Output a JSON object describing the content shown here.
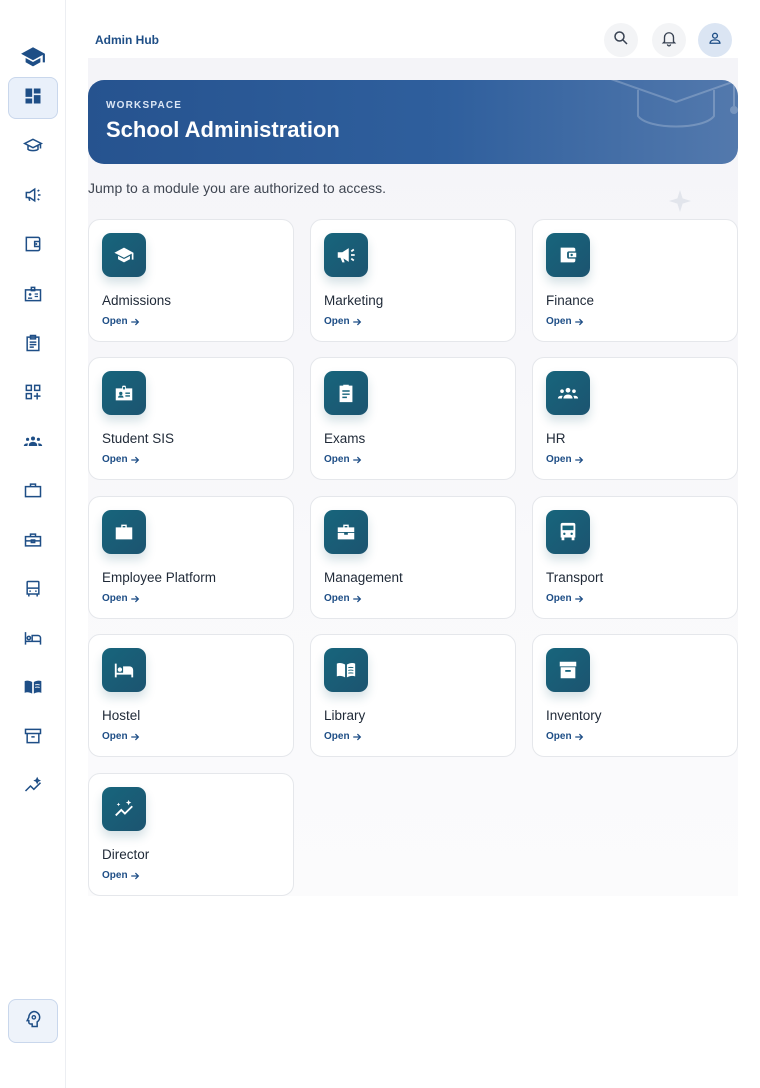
{
  "app": {
    "title": "Admin Hub"
  },
  "hero": {
    "eyebrow": "WORKSPACE",
    "title": "School Administration"
  },
  "subtitle": "Jump to a module you are authorized to access.",
  "colors": {
    "brand": "#1e4e86",
    "hero_start": "#26538f",
    "icon_tile": "#17657c"
  },
  "sidebar": {
    "items": [
      {
        "icon": "dashboard-icon",
        "active": true
      },
      {
        "icon": "graduation-cap-icon"
      },
      {
        "icon": "megaphone-icon"
      },
      {
        "icon": "wallet-icon"
      },
      {
        "icon": "id-badge-icon"
      },
      {
        "icon": "clipboard-icon"
      },
      {
        "icon": "add-widget-icon"
      },
      {
        "icon": "group-icon"
      },
      {
        "icon": "briefcase-icon"
      },
      {
        "icon": "toolbox-icon"
      },
      {
        "icon": "bus-icon"
      },
      {
        "icon": "bed-icon"
      },
      {
        "icon": "book-icon"
      },
      {
        "icon": "archive-icon"
      },
      {
        "icon": "analytics-icon"
      }
    ],
    "bottom_icon": "psychology-icon"
  },
  "modules": [
    {
      "name": "Admissions",
      "icon": "graduation-cap-icon",
      "action": "Open"
    },
    {
      "name": "Marketing",
      "icon": "megaphone-icon",
      "action": "Open"
    },
    {
      "name": "Finance",
      "icon": "wallet-icon",
      "action": "Open"
    },
    {
      "name": "Student SIS",
      "icon": "id-badge-icon",
      "action": "Open"
    },
    {
      "name": "Exams",
      "icon": "clipboard-icon",
      "action": "Open"
    },
    {
      "name": "HR",
      "icon": "group-icon",
      "action": "Open"
    },
    {
      "name": "Employee Platform",
      "icon": "briefcase-icon",
      "action": "Open"
    },
    {
      "name": "Management",
      "icon": "toolbox-icon",
      "action": "Open"
    },
    {
      "name": "Transport",
      "icon": "bus-icon",
      "action": "Open"
    },
    {
      "name": "Hostel",
      "icon": "bed-icon",
      "action": "Open"
    },
    {
      "name": "Library",
      "icon": "book-icon",
      "action": "Open"
    },
    {
      "name": "Inventory",
      "icon": "archive-icon",
      "action": "Open"
    },
    {
      "name": "Director",
      "icon": "analytics-icon",
      "action": "Open"
    }
  ]
}
